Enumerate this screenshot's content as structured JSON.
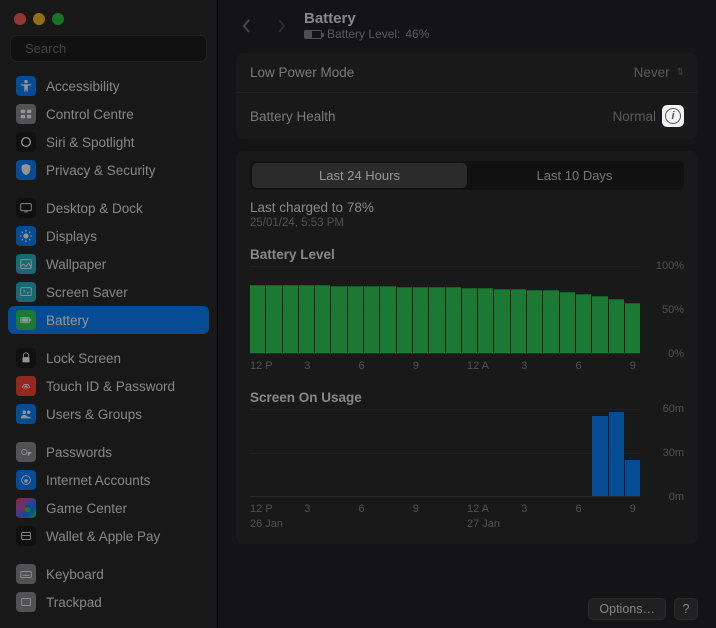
{
  "search": {
    "placeholder": "Search"
  },
  "sidebar": {
    "groups": [
      [
        {
          "icon": "accessibility",
          "bg": "#0a84ff",
          "label": "Accessibility"
        },
        {
          "icon": "control",
          "bg": "#8e8e93",
          "label": "Control Centre"
        },
        {
          "icon": "siri",
          "bg": "#1c1c1e",
          "label": "Siri & Spotlight"
        },
        {
          "icon": "privacy",
          "bg": "#0a84ff",
          "label": "Privacy & Security"
        }
      ],
      [
        {
          "icon": "desktop",
          "bg": "#1c1c1e",
          "label": "Desktop & Dock"
        },
        {
          "icon": "displays",
          "bg": "#0a84ff",
          "label": "Displays"
        },
        {
          "icon": "wallpaper",
          "bg": "#2bb3c8",
          "label": "Wallpaper"
        },
        {
          "icon": "screensaver",
          "bg": "#2bb3c8",
          "label": "Screen Saver"
        },
        {
          "icon": "battery",
          "bg": "#30d158",
          "label": "Battery",
          "selected": true
        }
      ],
      [
        {
          "icon": "lock",
          "bg": "#1c1c1e",
          "label": "Lock Screen"
        },
        {
          "icon": "touchid",
          "bg": "#ff453a",
          "label": "Touch ID & Password"
        },
        {
          "icon": "users",
          "bg": "#0a84ff",
          "label": "Users & Groups"
        }
      ],
      [
        {
          "icon": "passwords",
          "bg": "#8e8e93",
          "label": "Passwords"
        },
        {
          "icon": "internet",
          "bg": "#0a84ff",
          "label": "Internet Accounts"
        },
        {
          "icon": "gamecenter",
          "bg": "linear-gradient(135deg,#ff453a,#af52de,#0a84ff,#30d158)",
          "label": "Game Center"
        },
        {
          "icon": "wallet",
          "bg": "#1c1c1e",
          "label": "Wallet & Apple Pay"
        }
      ],
      [
        {
          "icon": "keyboard",
          "bg": "#8e8e93",
          "label": "Keyboard"
        },
        {
          "icon": "trackpad",
          "bg": "#8e8e93",
          "label": "Trackpad"
        }
      ]
    ]
  },
  "header": {
    "title": "Battery",
    "subtitle_prefix": "Battery Level:",
    "subtitle_value": "46%"
  },
  "settings": {
    "low_power_label": "Low Power Mode",
    "low_power_value": "Never",
    "health_label": "Battery Health",
    "health_value": "Normal"
  },
  "tabs": {
    "t1": "Last 24 Hours",
    "t2": "Last 10 Days",
    "active": 0
  },
  "last_charge": {
    "line1": "Last charged to 78%",
    "line2": "25/01/24, 5:53 PM"
  },
  "sections": {
    "level": "Battery Level",
    "usage": "Screen On Usage"
  },
  "x_ticks": [
    "12 P",
    "3",
    "6",
    "9",
    "12 A",
    "3",
    "6",
    "9"
  ],
  "dates": [
    "26 Jan",
    "27 Jan"
  ],
  "y_level": [
    "100%",
    "50%",
    "0%"
  ],
  "y_usage": [
    "60m",
    "30m",
    "0m"
  ],
  "footer": {
    "options": "Options…",
    "help": "?"
  },
  "chart_data": [
    {
      "type": "bar",
      "title": "Battery Level",
      "ylabel": "%",
      "ylim": [
        0,
        100
      ],
      "x": [
        "12 P",
        "3",
        "6",
        "9",
        "12 A",
        "3",
        "6",
        "9"
      ],
      "values_hourly_pct": [
        78,
        78,
        78,
        78,
        78,
        77,
        77,
        77,
        77,
        76,
        76,
        76,
        76,
        75,
        75,
        74,
        74,
        73,
        72,
        70,
        68,
        65,
        62,
        58
      ]
    },
    {
      "type": "bar",
      "title": "Screen On Usage",
      "ylabel": "minutes",
      "ylim": [
        0,
        60
      ],
      "x": [
        "12 P",
        "3",
        "6",
        "9",
        "12 A",
        "3",
        "6",
        "9"
      ],
      "values_hourly_min": [
        0,
        0,
        0,
        0,
        0,
        0,
        0,
        0,
        0,
        0,
        0,
        0,
        0,
        0,
        0,
        0,
        0,
        0,
        0,
        0,
        0,
        55,
        58,
        25
      ]
    }
  ]
}
